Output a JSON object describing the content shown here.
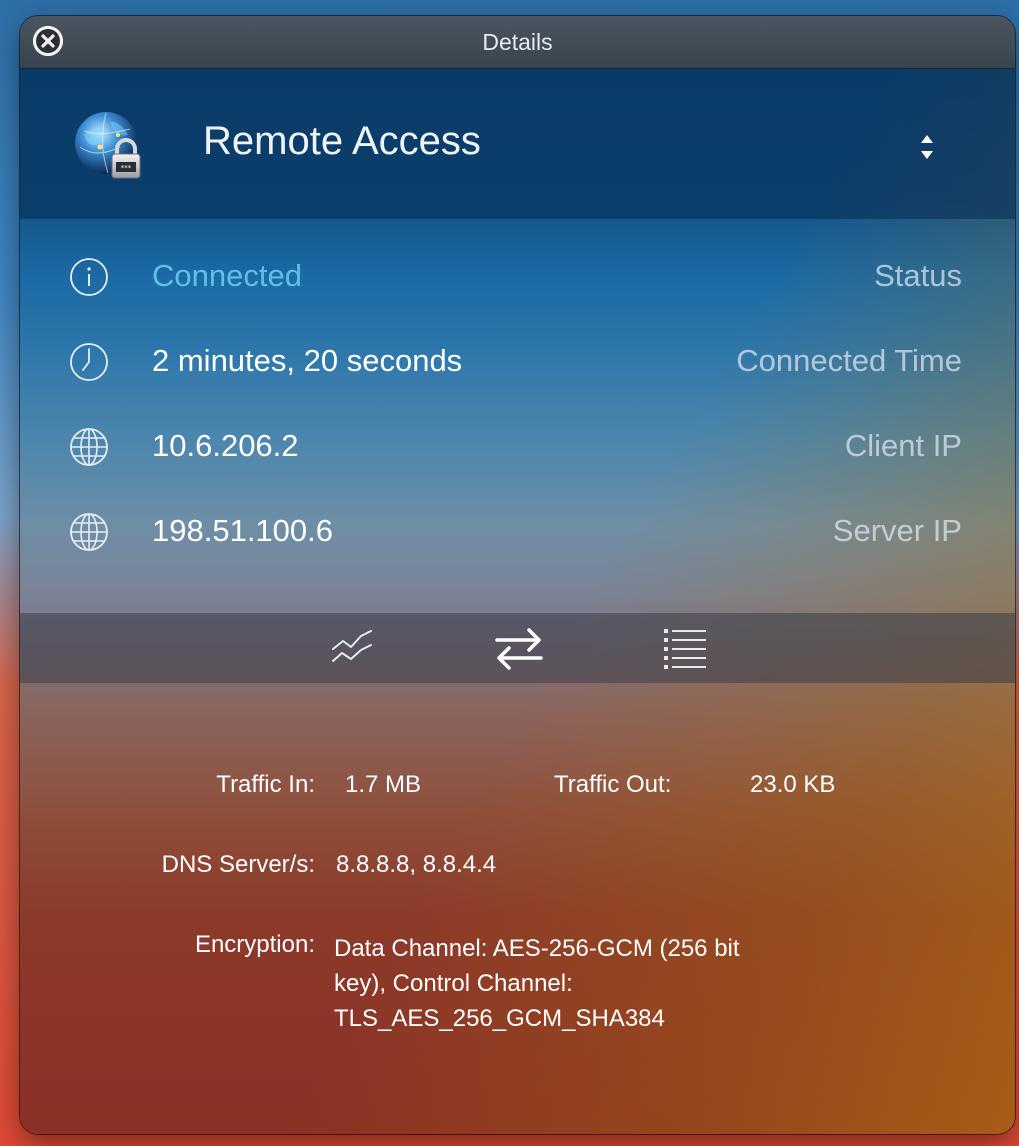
{
  "window": {
    "title": "Details"
  },
  "header": {
    "profile_name": "Remote Access"
  },
  "rows": [
    {
      "icon": "info-icon",
      "value": "Connected",
      "label": "Status"
    },
    {
      "icon": "clock-icon",
      "value": "2 minutes, 20 seconds",
      "label": "Connected Time"
    },
    {
      "icon": "globe-icon",
      "value": "10.6.206.2",
      "label": "Client IP"
    },
    {
      "icon": "globe-icon",
      "value": "198.51.100.6",
      "label": "Server IP"
    }
  ],
  "toolbar": {
    "buttons": [
      "graph-icon",
      "transfer-icon",
      "list-icon"
    ]
  },
  "details": {
    "traffic_in_label": "Traffic In:",
    "traffic_in_value": "1.7 MB",
    "traffic_out_label": "Traffic Out:",
    "traffic_out_value": "23.0 KB",
    "dns_label": "DNS Server/s:",
    "dns_value": "8.8.8.8, 8.8.4.4",
    "encryption_label": "Encryption:",
    "encryption_lines": [
      "Data Channel: AES-256-GCM (256 bit",
      "key), Control Channel:",
      "TLS_AES_256_GCM_SHA384"
    ]
  },
  "colors": {
    "connected_accent": "#62bde8",
    "titlebar": "#404a55"
  }
}
